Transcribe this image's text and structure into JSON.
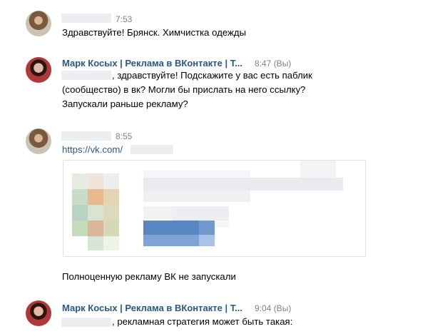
{
  "messages": [
    {
      "time": "7:53",
      "text": "Здравствуйте! Брянск. Химчистка одежды"
    },
    {
      "author": "Марк Косых | Реклама в ВКонтакте | Т...",
      "time": "8:47 (Вы)",
      "lines": [
        ", здравствуйте! Подскажите у вас есть паблик",
        "(сообщество) в вк? Могли бы прислать на него ссылку?",
        "Запускали раньше рекламу?"
      ]
    },
    {
      "time": "8:55",
      "link": "https://vk.com/"
    },
    {
      "text": "Полноценную рекламу ВК не запускали"
    },
    {
      "author": "Марк Косых | Реклама в ВКонтакте | Т...",
      "time": "9:04 (Вы)",
      "text": ", рекламная стратегия может быть такая:"
    }
  ]
}
